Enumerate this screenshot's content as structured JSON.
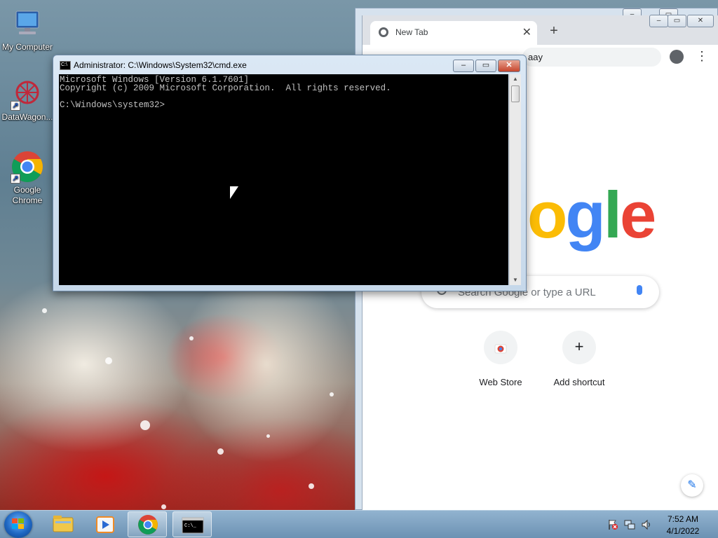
{
  "desktop": {
    "icons": [
      {
        "label": "My Computer"
      },
      {
        "label": "DataWagon..."
      },
      {
        "label": "Google Chrome"
      }
    ]
  },
  "cmd": {
    "title": "Administrator: C:\\Windows\\System32\\cmd.exe",
    "icon_text": "C:\\",
    "lines": [
      "Microsoft Windows [Version 6.1.7601]",
      "Copyright (c) 2009 Microsoft Corporation.  All rights reserved.",
      "",
      "C:\\Windows\\system32>"
    ]
  },
  "chrome": {
    "tab_title": "New Tab",
    "omnibox_text": "aay",
    "logo_visible_text": "ogle",
    "search_placeholder": "Search Google or type a URL",
    "shortcuts": [
      {
        "label": "Web Store"
      },
      {
        "label": "Add shortcut"
      }
    ]
  },
  "taskbar": {
    "time": "7:52 AM",
    "date": "4/1/2022"
  },
  "colors": {
    "google_blue": "#4285f4",
    "google_red": "#ea4335",
    "google_yellow": "#fbbc05",
    "google_green": "#34a853"
  }
}
